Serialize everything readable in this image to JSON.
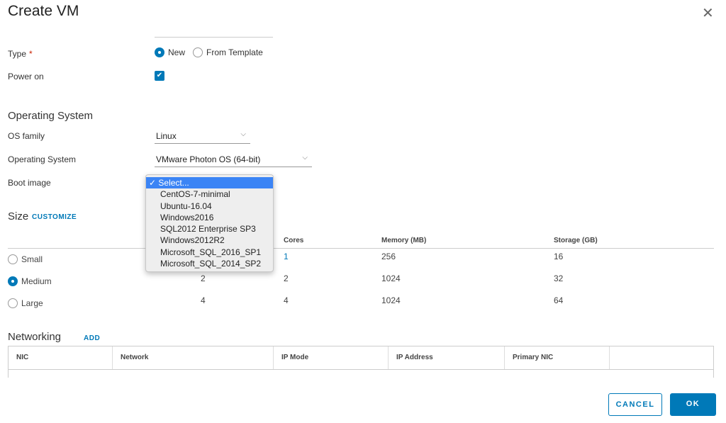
{
  "title": "Create VM",
  "type": {
    "label": "Type",
    "required": "*",
    "options": [
      "New",
      "From Template"
    ],
    "selected": "New"
  },
  "power_on": {
    "label": "Power on",
    "checked": true
  },
  "os": {
    "heading": "Operating System",
    "family_label": "OS family",
    "family_value": "Linux",
    "os_label": "Operating System",
    "os_value": "VMware Photon OS (64-bit)",
    "boot_label": "Boot image",
    "boot_options": [
      "Select...",
      "CentOS-7-minimal",
      "Ubuntu-16.04",
      "Windows2016",
      "SQL2012 Enterprise SP3",
      "Windows2012R2",
      "Microsoft_SQL_2016_SP1",
      "Microsoft_SQL_2014_SP2"
    ],
    "boot_selected": "Select..."
  },
  "size": {
    "heading": "Size",
    "customize": "CUSTOMIZE",
    "columns": [
      "Cores",
      "Memory (MB)",
      "Storage (GB)"
    ],
    "rows": [
      {
        "name": "Small",
        "cpus": "",
        "cores": "1",
        "memory": "256",
        "storage": "16"
      },
      {
        "name": "Medium",
        "cpus": "2",
        "cores": "2",
        "memory": "1024",
        "storage": "32"
      },
      {
        "name": "Large",
        "cpus": "4",
        "cores": "4",
        "memory": "1024",
        "storage": "64"
      }
    ],
    "selected": "Medium"
  },
  "networking": {
    "heading": "Networking",
    "add": "ADD",
    "columns": [
      "NIC",
      "Network",
      "IP Mode",
      "IP Address",
      "Primary NIC"
    ]
  },
  "buttons": {
    "cancel": "CANCEL",
    "ok": "OK"
  },
  "colors": {
    "accent": "#0079b8",
    "highlight": "#3b84f5"
  }
}
